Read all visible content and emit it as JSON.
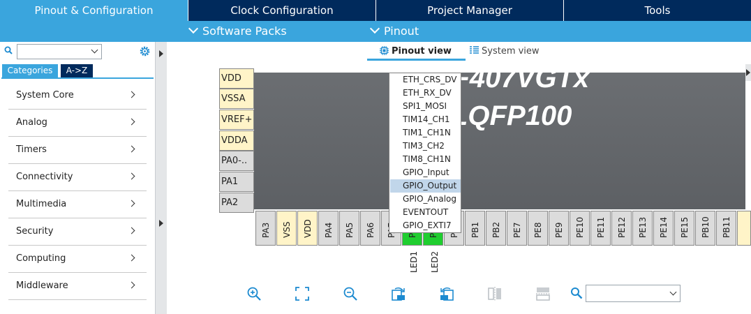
{
  "tabs": [
    "Pinout & Configuration",
    "Clock Configuration",
    "Project Manager",
    "Tools"
  ],
  "subnav": {
    "software_packs": "Software Packs",
    "pinout": "Pinout"
  },
  "left": {
    "tab_categories": "Categories",
    "tab_az": "A->Z",
    "categories": [
      "System Core",
      "Analog",
      "Timers",
      "Connectivity",
      "Multimedia",
      "Security",
      "Computing",
      "Middleware"
    ]
  },
  "views": {
    "pinout": "Pinout view",
    "system": "System view"
  },
  "chip": {
    "line1": "32F407VGTx",
    "line2": "LQFP100"
  },
  "left_pins": [
    "VDD",
    "VSSA",
    "VREF+",
    "VDDA",
    "PA0-..",
    "PA1",
    "PA2"
  ],
  "bottom_pins": [
    "PA3",
    "VSS",
    "VDD",
    "PA4",
    "PA5",
    "PA6",
    "PA7",
    "PC4",
    "PC5",
    "PB0",
    "PB1",
    "PB2",
    "PE7",
    "PE8",
    "PE9",
    "PE10",
    "PE11",
    "PE12",
    "PE13",
    "PE14",
    "PE15",
    "PB10",
    "PB11"
  ],
  "pin_labels": [
    "LED1",
    "LED2"
  ],
  "dropdown_items": [
    "ETH_CRS_DV",
    "ETH_RX_DV",
    "SPI1_MOSI",
    "TIM14_CH1",
    "TIM1_CH1N",
    "TIM3_CH2",
    "TIM8_CH1N",
    "GPIO_Input",
    "GPIO_Output",
    "GPIO_Analog",
    "EVENTOUT",
    "GPIO_EXTI7"
  ],
  "dropdown_selected": "GPIO_Output",
  "colors": {
    "accent": "#3aa5dd",
    "dark_tab": "#002a5c",
    "pin_power": "#fff4c8",
    "pin_gpio": "#1fce2f",
    "selected_item": "#c1d6ea"
  }
}
